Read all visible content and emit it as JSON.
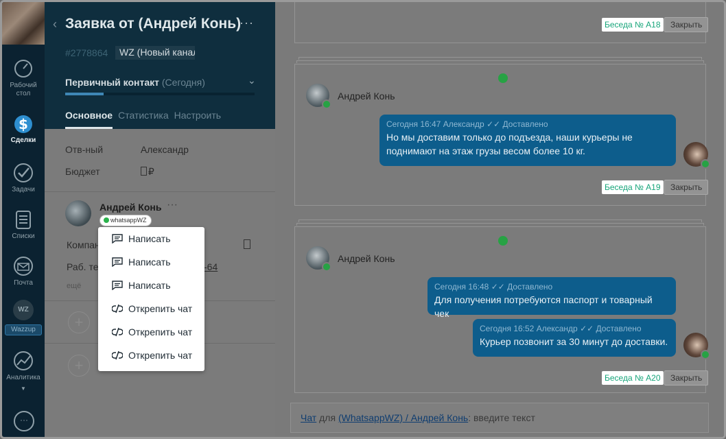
{
  "nav": {
    "items": [
      {
        "label1": "Рабочий",
        "label2": "стол",
        "icon": "dashboard-icon"
      },
      {
        "label": "Сделки",
        "icon": "deals-icon",
        "active": true
      },
      {
        "label": "Задачи",
        "icon": "tasks-icon"
      },
      {
        "label": "Списки",
        "icon": "lists-icon"
      },
      {
        "label": "Почта",
        "icon": "mail-icon"
      },
      {
        "badge": "WZ",
        "label": "Wazzup",
        "icon": "wazzup-icon"
      },
      {
        "label": "Аналитика",
        "icon": "analytics-icon"
      }
    ]
  },
  "lead": {
    "back": "‹",
    "title": "Заявка от (Андрей Конь)",
    "menu": "···",
    "id": "#2778864",
    "tag": "WZ (Новый канал)",
    "stage": "Первичный контакт",
    "stage_when": "(Сегодня)",
    "tabs": [
      "Основное",
      "Статистика",
      "Настроить"
    ],
    "responsible_label": "Отв-ный",
    "responsible_value": "Александр",
    "budget_label": "Бюджет",
    "budget_value": "₽"
  },
  "contact": {
    "name": "Андрей Конь",
    "menu": "···",
    "channel_badge": "whatsappWZ",
    "company_label": "Компан",
    "phone_label": "Раб. тел",
    "phone_tail": "-64",
    "more": "ещё"
  },
  "popup": {
    "items": [
      {
        "label": "Написать",
        "icon": "message-icon"
      },
      {
        "label": "Написать",
        "icon": "message-icon"
      },
      {
        "label": "Написать",
        "icon": "message-icon"
      },
      {
        "label": "Открепить чат",
        "icon": "unlink-icon"
      },
      {
        "label": "Открепить чат",
        "icon": "unlink-icon"
      },
      {
        "label": "Открепить чат",
        "icon": "unlink-icon"
      }
    ]
  },
  "chat": {
    "close_label": "Закрыть",
    "conv_a18": "Беседа № A18",
    "card2": {
      "peer": "Андрей Конь",
      "msg1_meta": "Сегодня 16:47 Александр ✓✓ Доставлено",
      "msg1_text": "Но мы доставим только до подъезда, наши курьеры не поднимают на этаж грузы весом более 10 кг.",
      "conv": "Беседа № A19"
    },
    "card3": {
      "peer": "Андрей Конь",
      "msg1_meta": "Сегодня 16:48 ✓✓ Доставлено",
      "msg1_text": "Для получения потребуются паспорт и товарный чек",
      "msg2_meta": "Сегодня 16:52 Александр ✓✓ Доставлено",
      "msg2_text": "Курьер позвонит за 30 минут до доставки.",
      "conv": "Беседа № A20"
    },
    "composer": {
      "link1": "Чат",
      "mid": " для ",
      "link2": "(WhatsappWZ) / Андрей Конь",
      "hint": ": введите текст"
    }
  },
  "colors": {
    "nav_bg": "#0b2231",
    "lead_header_bg": "#0f2e3e",
    "bubble_bg": "#0d5d8c",
    "whatsapp_green": "#27a244",
    "conv_green": "#17a57a"
  }
}
